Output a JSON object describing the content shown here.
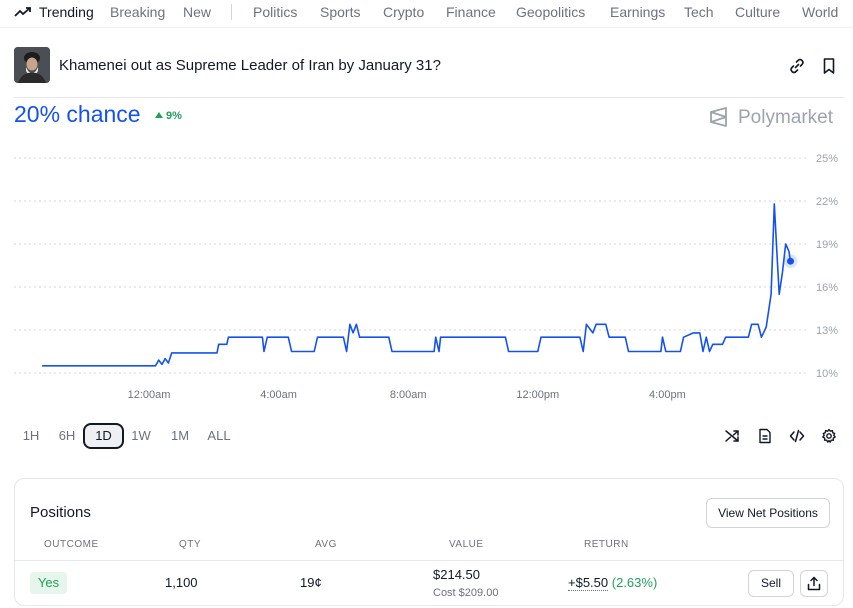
{
  "nav": {
    "trending": "Trending",
    "items": [
      "Breaking",
      "New",
      "Politics",
      "Sports",
      "Crypto",
      "Finance",
      "Geopolitics",
      "Earnings",
      "Tech",
      "Culture",
      "World"
    ]
  },
  "market": {
    "title": "Khamenei out as Supreme Leader of Iran by January 31?",
    "chance": "20% chance",
    "delta": "9%",
    "brand": "Polymarket"
  },
  "chart_data": {
    "type": "line",
    "x_ticks": [
      "12:00am",
      "4:00am",
      "8:00am",
      "12:00pm",
      "4:00pm"
    ],
    "y_ticks": [
      "25%",
      "22%",
      "19%",
      "16%",
      "13%",
      "10%"
    ],
    "ylim": [
      10,
      25
    ],
    "series": [
      {
        "color": "#1452f0",
        "points": [
          [
            -3.3,
            10.5
          ],
          [
            0.2,
            10.5
          ],
          [
            0.3,
            10.9
          ],
          [
            0.4,
            10.6
          ],
          [
            0.5,
            11.0
          ],
          [
            0.6,
            10.7
          ],
          [
            0.7,
            11.4
          ],
          [
            2.1,
            11.4
          ],
          [
            2.15,
            12.0
          ],
          [
            2.4,
            12.0
          ],
          [
            2.45,
            12.5
          ],
          [
            3.5,
            12.5
          ],
          [
            3.55,
            11.5
          ],
          [
            3.65,
            12.5
          ],
          [
            4.3,
            12.5
          ],
          [
            4.4,
            11.5
          ],
          [
            5.1,
            11.5
          ],
          [
            5.2,
            12.5
          ],
          [
            6.0,
            12.5
          ],
          [
            6.1,
            11.5
          ],
          [
            6.2,
            13.4
          ],
          [
            6.3,
            12.8
          ],
          [
            6.4,
            13.4
          ],
          [
            6.5,
            12.5
          ],
          [
            7.4,
            12.5
          ],
          [
            7.5,
            11.5
          ],
          [
            8.8,
            11.5
          ],
          [
            8.85,
            12.5
          ],
          [
            8.95,
            11.5
          ],
          [
            9.0,
            12.5
          ],
          [
            11.0,
            12.5
          ],
          [
            11.1,
            11.5
          ],
          [
            12.0,
            11.5
          ],
          [
            12.1,
            12.5
          ],
          [
            13.3,
            12.5
          ],
          [
            13.4,
            11.5
          ],
          [
            13.5,
            13.4
          ],
          [
            13.7,
            12.8
          ],
          [
            13.8,
            13.4
          ],
          [
            14.1,
            13.4
          ],
          [
            14.2,
            12.5
          ],
          [
            14.7,
            12.5
          ],
          [
            14.8,
            11.5
          ],
          [
            15.8,
            11.5
          ],
          [
            15.85,
            12.5
          ],
          [
            15.95,
            11.5
          ],
          [
            16.4,
            11.5
          ],
          [
            16.5,
            12.5
          ],
          [
            16.8,
            12.8
          ],
          [
            17.0,
            12.8
          ],
          [
            17.1,
            11.5
          ],
          [
            17.2,
            12.5
          ],
          [
            17.3,
            11.5
          ],
          [
            17.4,
            12.0
          ],
          [
            17.7,
            12.0
          ],
          [
            17.8,
            12.5
          ],
          [
            18.5,
            12.5
          ],
          [
            18.6,
            13.4
          ],
          [
            18.8,
            13.4
          ],
          [
            18.9,
            12.5
          ],
          [
            19.05,
            13.2
          ],
          [
            19.2,
            15.5
          ],
          [
            19.3,
            21.8
          ],
          [
            19.4,
            17.5
          ],
          [
            19.45,
            15.5
          ],
          [
            19.55,
            17.0
          ],
          [
            19.65,
            19.0
          ],
          [
            19.75,
            18.5
          ],
          [
            19.8,
            17.8
          ]
        ]
      }
    ]
  },
  "ranges": [
    "1H",
    "6H",
    "1D",
    "1W",
    "1M",
    "ALL"
  ],
  "active_range": "1D",
  "positions": {
    "title": "Positions",
    "net_button": "View Net Positions",
    "headers": [
      "OUTCOME",
      "QTY",
      "AVG",
      "VALUE",
      "RETURN"
    ],
    "row": {
      "outcome": "Yes",
      "qty": "1,100",
      "avg": "19¢",
      "value": "$214.50",
      "cost": "Cost $209.00",
      "return_amt": "+$5.50",
      "return_pct": "(2.63%)",
      "sell": "Sell"
    }
  }
}
